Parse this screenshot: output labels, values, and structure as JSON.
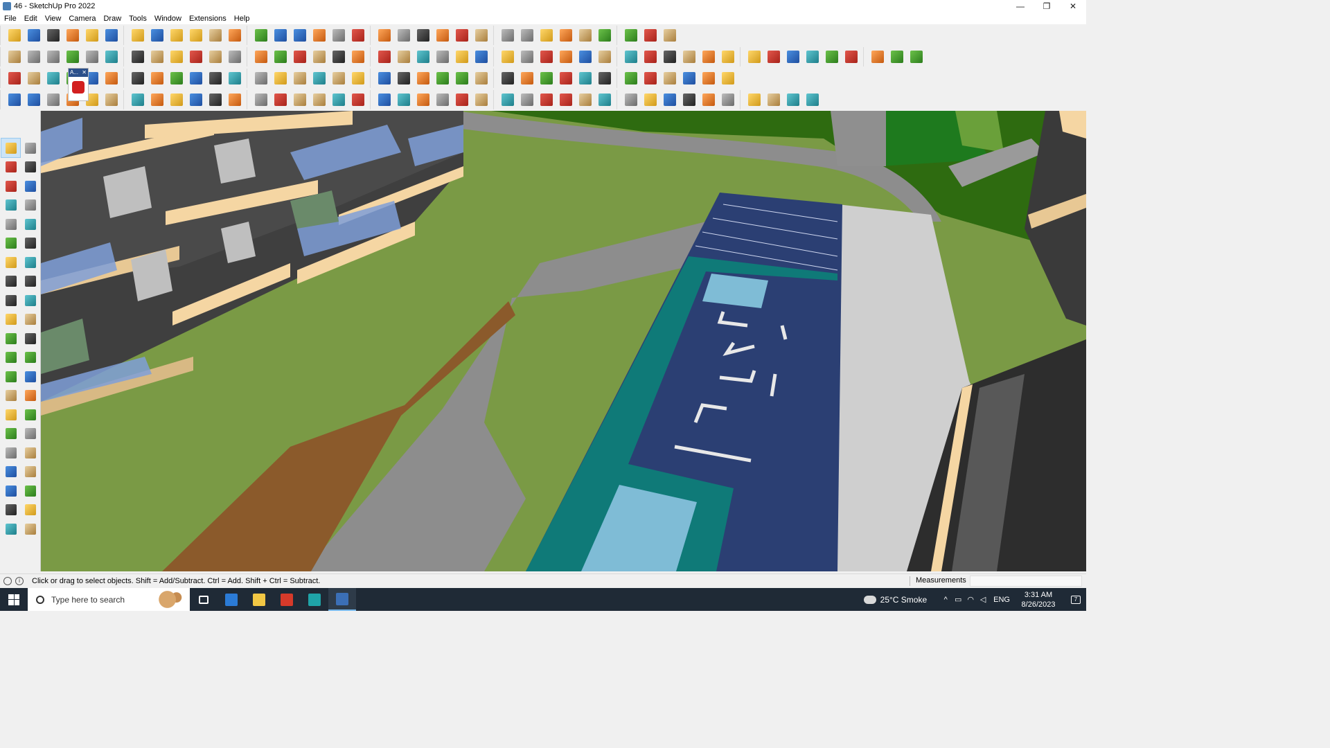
{
  "window": {
    "title": "46 - SketchUp Pro 2022",
    "minimize": "—",
    "restore": "❐",
    "close": "✕"
  },
  "menu": [
    "File",
    "Edit",
    "View",
    "Camera",
    "Draw",
    "Tools",
    "Window",
    "Extensions",
    "Help"
  ],
  "toolbar_icons": {
    "row1": [
      "search-icon",
      "select-icon",
      "eraser-icon",
      "pencil-icon",
      "lasso-icon",
      "paint-icon",
      "push-pull-icon",
      "follow-me-icon",
      "move-icon",
      "rotate-icon",
      "scale-icon",
      "tape-icon",
      "text-icon",
      "paint-bucket-icon",
      "orbit-icon",
      "pan-icon",
      "zoom-icon",
      "zoom-extents-icon",
      "warehouse-icon",
      "components-icon",
      "layers-icon",
      "styles-icon",
      "user-icon",
      "section-plane-icon",
      "section-cut-icon",
      "axis-icon",
      "flip-icon",
      "intersect-icon",
      "align-icon",
      "perspective-icon",
      "undo-icon",
      "redo-icon",
      "hand-icon"
    ],
    "row2": [
      "box-icon",
      "shaded-box-icon",
      "textured-box-icon",
      "push-icon",
      "extrude-icon",
      "solid-tools-icon",
      "union-icon",
      "subtract-icon",
      "trim-icon",
      "split-icon",
      "shell-icon",
      "arc-icon",
      "soften-icon",
      "flip-x-icon",
      "flip-y-icon",
      "flip-z-icon",
      "sandbox-icon",
      "terrain-icon",
      "house-icon",
      "house-icon",
      "house-icon",
      "house-icon",
      "house-icon",
      "fence-icon",
      "lightning-icon",
      "leaf-icon",
      "pen-icon",
      "rectangle-icon",
      "circle-icon",
      "hexagon-icon",
      "ellipse-icon",
      "parallelogram-icon",
      "arc-icon",
      "spiral-icon",
      "curve-icon",
      "path-icon",
      "offset-icon",
      "measure-icon",
      "material-icon",
      "texture-icon",
      "render-icon",
      "camera-icon",
      "hat-icon",
      "box-icon",
      "photo-icon"
    ],
    "row3": [
      "plane-icon",
      "plane-icon",
      "plane-icon",
      "page-icon",
      "arc-icon",
      "red-square-icon",
      "stack-icon",
      "frame-icon",
      "curve-icon",
      "bend-icon",
      "dots-icon",
      "cross-icon",
      "cross-icon",
      "cross-icon",
      "cone-icon",
      "cone-icon",
      "triangle-icon",
      "loop-icon",
      "knot-icon",
      "ring-icon",
      "move-icon",
      "cube-icon",
      "magnet-icon",
      "grid-icon",
      "links-icon",
      "links-icon",
      "links-icon",
      "links-icon",
      "box-icon",
      "window-icon",
      "tile-icon",
      "tile-icon",
      "tile-icon",
      "scatter-icon",
      "curve-icon",
      "grid-icon"
    ],
    "row4": [
      "line-icon",
      "bezier-icon",
      "car-icon",
      "stairs-icon",
      "ruler-icon",
      "pipe-icon",
      "bowl-icon",
      "globe-icon",
      "rail-icon",
      "rail-icon",
      "rail-icon",
      "rail-icon",
      "curve-icon",
      "arch-icon",
      "ramp-icon",
      "column-icon",
      "column-icon",
      "fan-icon",
      "leaf-icon",
      "hat-icon",
      "wave-icon",
      "stair-icon",
      "ramp-icon",
      "wire-icon",
      "wire-icon",
      "wire-icon",
      "box-icon",
      "hatch-icon",
      "hatch-icon",
      "hatch-icon",
      "hatch-icon",
      "hatch-icon",
      "hatch-icon",
      "hatch-icon",
      "hatch-icon",
      "sphere-icon",
      "sphere-icon",
      "hatch-icon",
      "hatch-icon",
      "diamond-icon"
    ]
  },
  "floating_chip": {
    "label": "A...",
    "close": "✕"
  },
  "left_tools": [
    "select-icon",
    "orbit-icon",
    "paint-bucket-icon",
    "eraser-icon",
    "components-icon",
    "pencil-icon",
    "line-icon",
    "freehand-icon",
    "rectangle-icon",
    "rotated-rectangle-icon",
    "circle-icon",
    "polygon-icon",
    "arc-icon",
    "two-point-arc-icon",
    "three-point-arc-icon",
    "pie-icon",
    "move-icon",
    "push-pull-icon",
    "rotate-icon",
    "follow-me-icon",
    "scale-icon",
    "offset-icon",
    "tape-measure-icon",
    "dimension-icon",
    "protractor-icon",
    "text-icon",
    "axes-icon",
    "3d-text-icon",
    "orbit-icon",
    "pan-icon",
    "zoom-icon",
    "zoom-window-icon",
    "zoom-extents-icon",
    "previous-view-icon",
    "position-camera-icon",
    "look-around-icon",
    "walk-icon",
    "section-plane-icon",
    "warehouse-icon",
    "extension-warehouse-icon",
    "layout-icon",
    "share-icon"
  ],
  "status": {
    "message": "Click or drag to select objects. Shift = Add/Subtract. Ctrl = Add. Shift + Ctrl = Subtract.",
    "measurements_label": "Measurements",
    "measurements_value": ""
  },
  "taskbar": {
    "search_placeholder": "Type here to search",
    "apps": [
      "task-view-icon",
      "calculator-icon",
      "file-explorer-icon",
      "autocad-icon",
      "3ds-max-icon",
      "sketchup-icon"
    ],
    "weather": "25°C  Smoke",
    "lang": "ENG",
    "time": "3:31 AM",
    "date": "8/26/2023",
    "notifications": "7"
  },
  "colors": {
    "grass": "#7a9a45",
    "dark_grass": "#2e6b10",
    "paving": "#8d8d8d",
    "deck": "#8b5a2b",
    "pool_deep": "#2b3f73",
    "pool_teal": "#0f7a78",
    "pool_light": "#7fbcd6",
    "walkway": "#cfcfcf",
    "building_cream": "#f5d6a3",
    "glass": "#7f9fd8"
  }
}
